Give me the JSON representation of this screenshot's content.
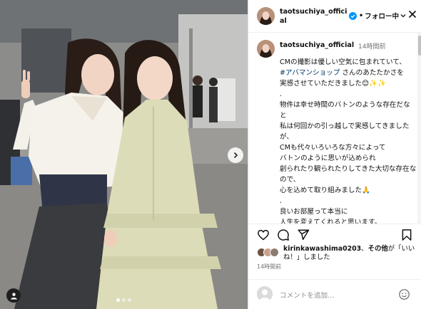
{
  "post": {
    "username": "taotsuchiya_official",
    "follow_state": "フォロー中",
    "caption_time": "14時間前",
    "caption_lines": [
      "CMの撮影は優しい空気に包まれていて、",
      "#アバマンショップ さんのあたたかさを",
      "実感させていただきました😊✨✨",
      ".",
      "物件は幸せ時間のバトンのような存在だなと",
      "私は何回かの引っ越しで実感してきましたが、",
      "CMも代々いろいろな方々によって",
      "バトンのように思いが込められ",
      "創られたり観られたりしてきた大切な存在なので、",
      "心を込めて取り組みました🙏",
      ".",
      "良いお部屋って本当に",
      "人生を変えてくれると思います。"
    ],
    "hashtag": "#アバマンショップ",
    "liked_by_user": "kirinkawashima0203",
    "liked_by_rest": "、",
    "liked_by_others": "その他",
    "liked_by_suffix": "が「いいね！」しました",
    "post_time": "14時間前",
    "comment_placeholder": "コメントを追加...",
    "carousel": {
      "count": 3,
      "active_index": 0
    }
  },
  "icons": {
    "header": [
      "verified-badge-icon",
      "chevron-down-icon",
      "close-icon"
    ],
    "actions": [
      "heart-icon",
      "comment-icon",
      "share-icon",
      "bookmark-icon"
    ],
    "photo": [
      "next-arrow-icon",
      "tag-user-icon"
    ],
    "comment": [
      "emoji-icon"
    ]
  },
  "colors": {
    "verified": "#0095f6",
    "link": "#00376b",
    "muted": "#737373",
    "border": "#dbdbdb"
  }
}
